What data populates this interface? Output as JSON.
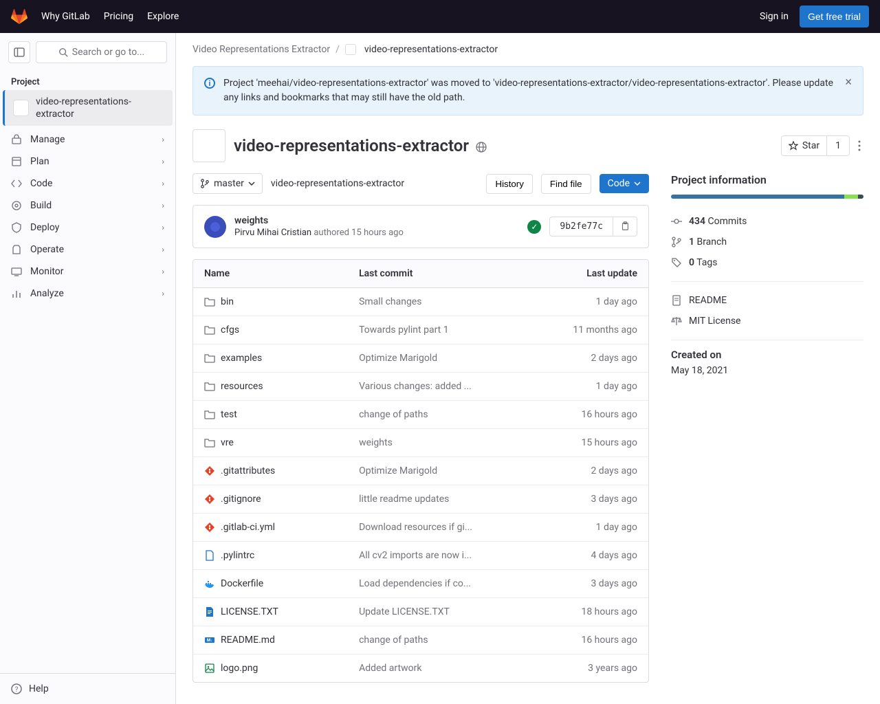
{
  "topbar": {
    "links": [
      "Why GitLab",
      "Pricing",
      "Explore"
    ],
    "signin": "Sign in",
    "trial": "Get free trial"
  },
  "sidebar": {
    "search_placeholder": "Search or go to...",
    "section_label": "Project",
    "project_name": "video-representations-extractor",
    "items": [
      {
        "label": "Manage"
      },
      {
        "label": "Plan"
      },
      {
        "label": "Code"
      },
      {
        "label": "Build"
      },
      {
        "label": "Deploy"
      },
      {
        "label": "Operate"
      },
      {
        "label": "Monitor"
      },
      {
        "label": "Analyze"
      }
    ],
    "help": "Help"
  },
  "breadcrumb": {
    "group": "Video Representations Extractor",
    "project": "video-representations-extractor"
  },
  "alert": {
    "text": "Project 'meehai/video-representations-extractor' was moved to 'video-representations-extractor/video-representations-extractor'. Please update any links and bookmarks that may still have the old path."
  },
  "project": {
    "title": "video-representations-extractor",
    "star": "Star",
    "star_count": "1"
  },
  "controls": {
    "branch": "master",
    "path": "video-representations-extractor",
    "history": "History",
    "find_file": "Find file",
    "code": "Code"
  },
  "commit": {
    "title": "weights",
    "author": "Pirvu Mihai Cristian",
    "authored": "authored",
    "time": "15 hours ago",
    "sha": "9b2fe77c"
  },
  "files": {
    "head": {
      "name": "Name",
      "commit": "Last commit",
      "update": "Last update"
    },
    "rows": [
      {
        "type": "folder",
        "name": "bin",
        "commit": "Small changes",
        "update": "1 day ago"
      },
      {
        "type": "folder",
        "name": "cfgs",
        "commit": "Towards pylint part 1",
        "update": "11 months ago"
      },
      {
        "type": "folder",
        "name": "examples",
        "commit": "Optimize Marigold",
        "update": "2 days ago"
      },
      {
        "type": "folder",
        "name": "resources",
        "commit": "Various changes: added ...",
        "update": "1 day ago"
      },
      {
        "type": "folder",
        "name": "test",
        "commit": "change of paths",
        "update": "16 hours ago"
      },
      {
        "type": "folder",
        "name": "vre",
        "commit": "weights",
        "update": "15 hours ago"
      },
      {
        "type": "git",
        "name": ".gitattributes",
        "commit": "Optimize Marigold",
        "update": "2 days ago"
      },
      {
        "type": "git",
        "name": ".gitignore",
        "commit": "little readme updates",
        "update": "3 days ago"
      },
      {
        "type": "git",
        "name": ".gitlab-ci.yml",
        "commit": "Download resources if gi...",
        "update": "1 day ago"
      },
      {
        "type": "file",
        "name": ".pylintrc",
        "commit": "All cv2 imports are now i...",
        "update": "4 days ago"
      },
      {
        "type": "docker",
        "name": "Dockerfile",
        "commit": "Load dependencies if co...",
        "update": "3 days ago"
      },
      {
        "type": "doc",
        "name": "LICENSE.TXT",
        "commit": "Update LICENSE.TXT",
        "update": "18 hours ago"
      },
      {
        "type": "md",
        "name": "README.md",
        "commit": "change of paths",
        "update": "16 hours ago"
      },
      {
        "type": "image",
        "name": "logo.png",
        "commit": "Added artwork",
        "update": "3 years ago"
      }
    ]
  },
  "info": {
    "heading": "Project information",
    "commits_n": "434",
    "commits_l": "Commits",
    "branches_n": "1",
    "branches_l": "Branch",
    "tags_n": "0",
    "tags_l": "Tags",
    "readme": "README",
    "license": "MIT License",
    "created_label": "Created on",
    "created_date": "May 18, 2021"
  }
}
